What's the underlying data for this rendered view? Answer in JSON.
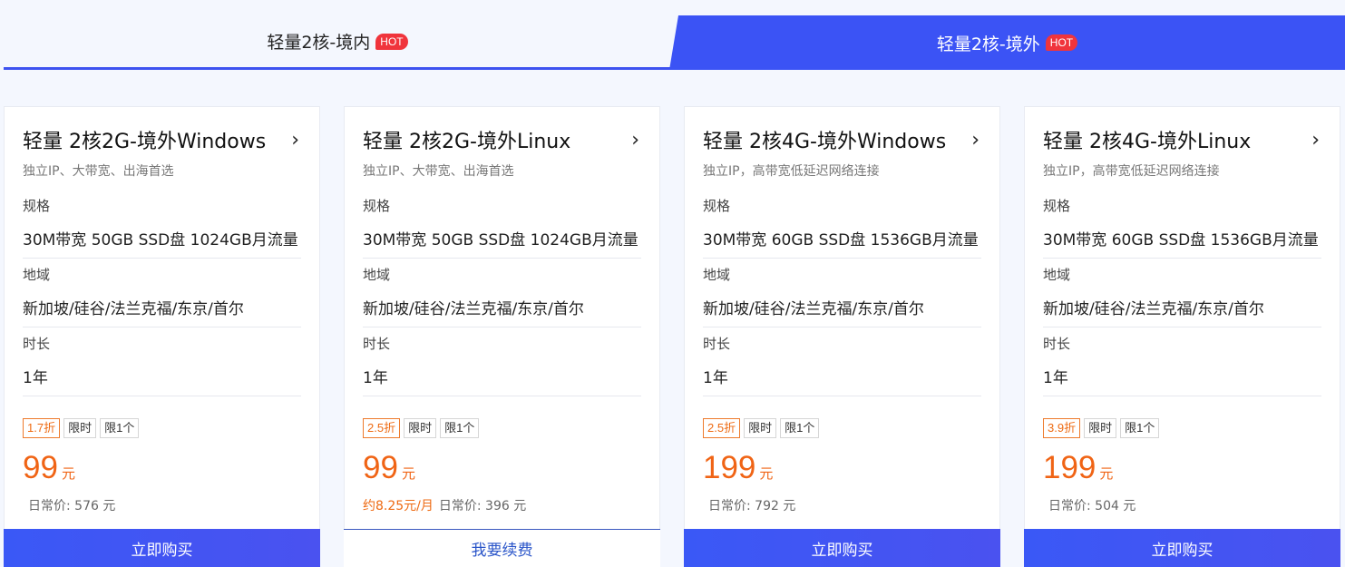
{
  "tabs": [
    {
      "label": "轻量2核-境内",
      "badge": "HOT",
      "active": false
    },
    {
      "label": "轻量2核-境外",
      "badge": "HOT",
      "active": true
    }
  ],
  "spec_labels": {
    "spec": "规格",
    "region": "地域",
    "duration": "时长"
  },
  "cards": [
    {
      "title": "轻量 2核2G-境外Windows",
      "subtitle": "独立IP、大带宽、出海首选",
      "spec": "30M带宽 50GB SSD盘 1024GB月流量",
      "region": "新加坡/硅谷/法兰克福/东京/首尔",
      "duration": "1年",
      "tags": [
        "1.7折",
        "限时",
        "限1个"
      ],
      "price": "99",
      "unit": "元",
      "monthly": "",
      "original": "日常价: 576 元",
      "button": "立即购买",
      "button_type": "buy"
    },
    {
      "title": "轻量 2核2G-境外Linux",
      "subtitle": "独立IP、大带宽、出海首选",
      "spec": "30M带宽 50GB SSD盘 1024GB月流量",
      "region": "新加坡/硅谷/法兰克福/东京/首尔",
      "duration": "1年",
      "tags": [
        "2.5折",
        "限时",
        "限1个"
      ],
      "price": "99",
      "unit": "元",
      "monthly": "约8.25元/月",
      "original": "日常价: 396 元",
      "button": "我要续费",
      "button_type": "renew"
    },
    {
      "title": "轻量 2核4G-境外Windows",
      "subtitle": "独立IP，高带宽低延迟网络连接",
      "spec": "30M带宽 60GB SSD盘 1536GB月流量",
      "region": "新加坡/硅谷/法兰克福/东京/首尔",
      "duration": "1年",
      "tags": [
        "2.5折",
        "限时",
        "限1个"
      ],
      "price": "199",
      "unit": "元",
      "monthly": "",
      "original": "日常价: 792 元",
      "button": "立即购买",
      "button_type": "buy"
    },
    {
      "title": "轻量 2核4G-境外Linux",
      "subtitle": "独立IP，高带宽低延迟网络连接",
      "spec": "30M带宽 60GB SSD盘 1536GB月流量",
      "region": "新加坡/硅谷/法兰克福/东京/首尔",
      "duration": "1年",
      "tags": [
        "3.9折",
        "限时",
        "限1个"
      ],
      "price": "199",
      "unit": "元",
      "monthly": "",
      "original": "日常价: 504 元",
      "button": "立即购买",
      "button_type": "buy"
    }
  ],
  "colors": {
    "accent": "#3b53f5",
    "price": "#f06415",
    "hot": "#f0343c"
  }
}
